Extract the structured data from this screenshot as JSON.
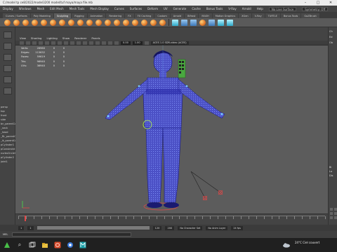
{
  "window": {
    "title": "C:/model tp ce8/2022/model3200 model/tuf maya/maya file.mb",
    "controls": [
      "–",
      "□",
      "✕"
    ]
  },
  "menubar": {
    "items": [
      "Display",
      "Windows",
      "Mesh",
      "Edit Mesh",
      "Mesh Tools",
      "Mesh Display",
      "Curves",
      "Surfaces",
      "Deform",
      "UV",
      "Generate",
      "Cache",
      "Bonus Tools",
      "V-Ray",
      "Arnold",
      "Help"
    ],
    "workspace_field": "Modeling",
    "no_live_surface": "No Live Surface",
    "symmetry": "Symmetry: Off"
  },
  "shelf": {
    "tabs": [
      "Curves / Surfaces",
      "Poly Modeling",
      "Sculpting",
      "Rigging",
      "Animation",
      "Rendering",
      "FX",
      "FX Caching",
      "Custom",
      "Arnold",
      "Bifrost",
      "MASH",
      "Motion Graphics",
      "XGen",
      "V-Ray",
      "TURTLE",
      "Bonus Tools",
      "GoZBrush"
    ],
    "active_tab": "Sculpting"
  },
  "panel": {
    "menus": [
      "View",
      "Shading",
      "Lighting",
      "Show",
      "Renderer",
      "Panels"
    ],
    "near_clip": "0.00",
    "far_clip": "1.00",
    "color_space": "ACES 1.0 SDR-video (ACES)"
  },
  "hud": {
    "rows": [
      {
        "label": "Verts:",
        "value": "26960",
        "a": "0",
        "b": "0"
      },
      {
        "label": "Edges:",
        "value": "115632",
        "a": "0",
        "b": "0"
      },
      {
        "label": "Faces:",
        "value": "59619",
        "a": "0",
        "b": "0"
      },
      {
        "label": "Tris:",
        "value": "96940",
        "a": "0",
        "b": "0"
      },
      {
        "label": "UVs:",
        "value": "36940",
        "a": "0",
        "b": "0"
      }
    ]
  },
  "viewport": {
    "mesh_color": "#2a2aa8",
    "wire_color": "#8a9aff",
    "handle_color": "#7ad0ff",
    "ik_color": "#e04848"
  },
  "channel_box": {
    "labels": [
      "Ch",
      "Ed",
      "Ob",
      "Bl",
      "La",
      "Dis"
    ]
  },
  "timeline": {
    "start": "1",
    "end": "120",
    "range_start": "1",
    "range_end": "120",
    "playback_end": "200",
    "current_frame_fraction": 0.02,
    "character_set": "No Character Set",
    "anim_layer": "No Anim Layer",
    "fps": "24 fps"
  },
  "command_line": {
    "mode": "MEL"
  },
  "taskbar": {
    "weather_temp": "24°C",
    "weather_text": "Ciel couvert"
  },
  "outliner": {
    "items": [
      "persp",
      "top",
      "front",
      "side",
      "bn_parentConst",
      "_neck",
      "_head",
      "_RL_parentC",
      "_ik_parentCo",
      "pCylinder1",
      "pConstraint",
      "nurbsCircle1",
      "pCylinder2",
      "joint1"
    ]
  }
}
